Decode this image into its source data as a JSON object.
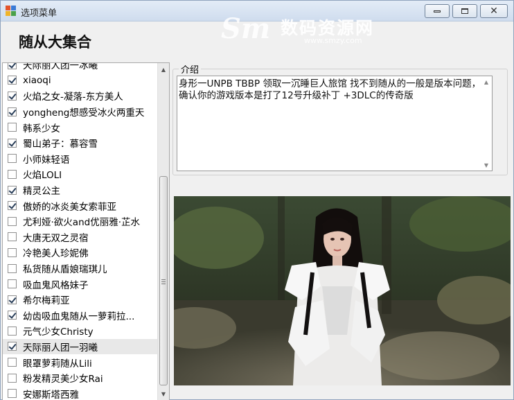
{
  "window": {
    "title": "选项菜单",
    "controls": {
      "minimize": "minimize-icon",
      "maximize": "maximize-icon",
      "close": "close-icon"
    }
  },
  "watermark": {
    "logo": "Sm",
    "name": "数码资源网",
    "url": "www.smzy.com"
  },
  "page_title": "随从大集合",
  "companions": [
    {
      "label": "天际丽人团一冰曦",
      "checked": true
    },
    {
      "label": "xiaoqi",
      "checked": true
    },
    {
      "label": "火焰之女-凝落-东方美人",
      "checked": true
    },
    {
      "label": "yongheng想感受冰火两重天",
      "checked": true
    },
    {
      "label": "韩系少女",
      "checked": false
    },
    {
      "label": "蜀山弟子：慕容雪",
      "checked": true
    },
    {
      "label": "小师妹轻语",
      "checked": false
    },
    {
      "label": "火焰LOLI",
      "checked": false
    },
    {
      "label": "精灵公主",
      "checked": true
    },
    {
      "label": "傲娇的冰炎美女索菲亚",
      "checked": true
    },
    {
      "label": "尤利娅·欲火and优丽雅·芷水",
      "checked": false
    },
    {
      "label": "大唐无双之灵宿",
      "checked": false
    },
    {
      "label": "冷艳美人珍妮佛",
      "checked": false
    },
    {
      "label": "私货随从盾娘瑞琪儿",
      "checked": false
    },
    {
      "label": "吸血鬼风格妹子",
      "checked": false
    },
    {
      "label": "希尔梅莉亚",
      "checked": true
    },
    {
      "label": "幼齿吸血鬼随从一萝莉拉...",
      "checked": true
    },
    {
      "label": "元气少女Christy",
      "checked": false
    },
    {
      "label": "天际丽人团一羽曦",
      "checked": true,
      "highlighted": true
    },
    {
      "label": "眼罩萝莉随从Lili",
      "checked": false
    },
    {
      "label": "粉发精灵美少女Rai",
      "checked": false
    },
    {
      "label": "安娜斯塔西雅",
      "checked": false
    }
  ],
  "intro": {
    "legend": "介绍",
    "text": "身形一UNPB TBBP 领取一沉睡巨人旅馆 找不到随从的一般是版本问题，确认你的游戏版本是打了12号升级补丁 +3DLC的传奇版"
  },
  "preview": {
    "alt": ""
  },
  "colors": {
    "title_gradient_top": "#e3ecf7",
    "title_gradient_bottom": "#cfdcee",
    "window_bg": "#f0f0f0",
    "check_mark": "#2a3f5a"
  }
}
